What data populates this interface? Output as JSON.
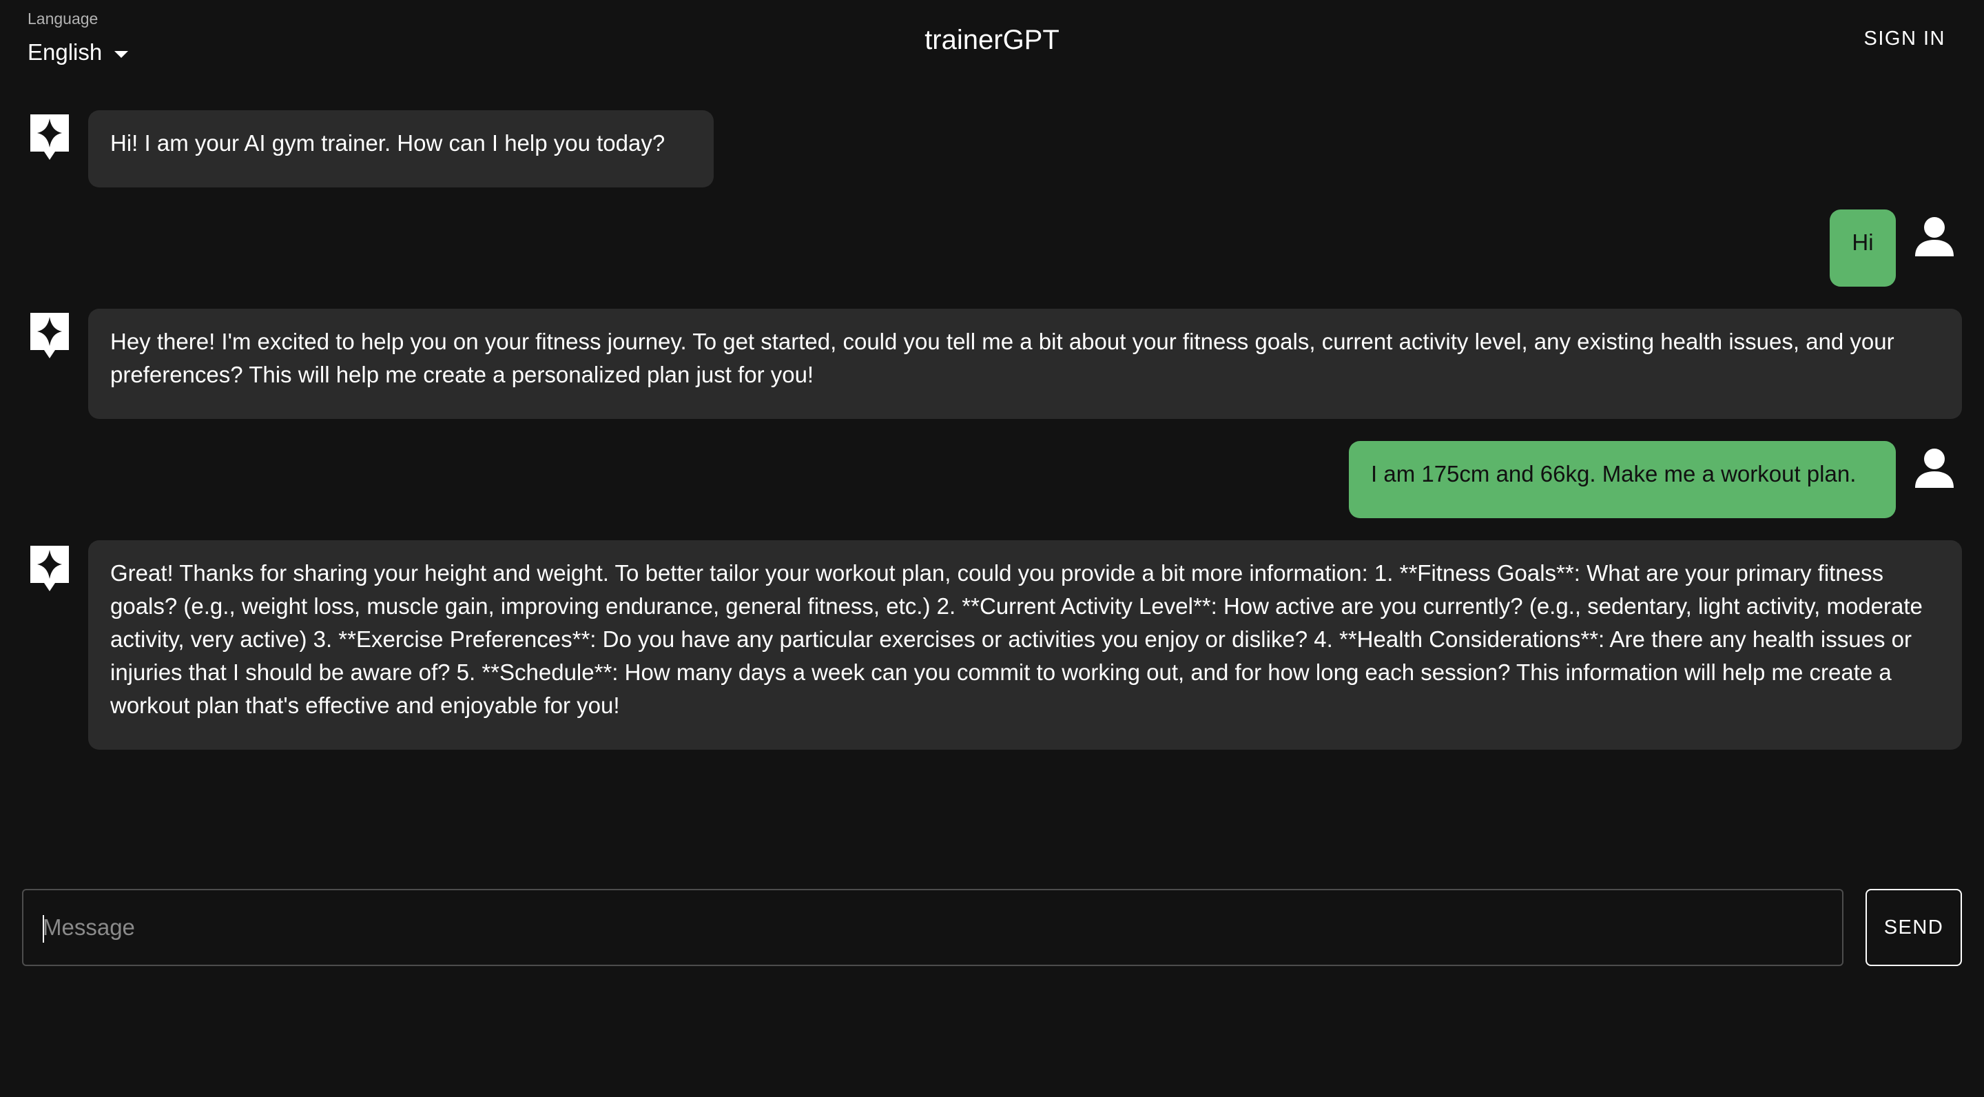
{
  "header": {
    "language_label": "Language",
    "language_value": "English",
    "title": "trainerGPT",
    "signin_label": "SIGN IN"
  },
  "messages": [
    {
      "role": "assistant",
      "icon": "sparkle-icon",
      "text": "Hi! I am your AI gym trainer. How can I help you today?"
    },
    {
      "role": "user",
      "icon": "user-icon",
      "text": "Hi"
    },
    {
      "role": "assistant",
      "icon": "sparkle-icon",
      "text": "Hey there! I'm excited to help you on your fitness journey. To get started, could you tell me a bit about your fitness goals, current activity level, any existing health issues, and your preferences? This will help me create a personalized plan just for you!"
    },
    {
      "role": "user",
      "icon": "user-icon",
      "text": "I am 175cm and 66kg. Make me a workout plan."
    },
    {
      "role": "assistant",
      "icon": "sparkle-icon",
      "text": "Great! Thanks for sharing your height and weight. To better tailor your workout plan, could you provide a bit more information: 1. **Fitness Goals**: What are your primary fitness goals? (e.g., weight loss, muscle gain, improving endurance, general fitness, etc.) 2. **Current Activity Level**: How active are you currently? (e.g., sedentary, light activity, moderate activity, very active) 3. **Exercise Preferences**: Do you have any particular exercises or activities you enjoy or dislike? 4. **Health Considerations**: Are there any health issues or injuries that I should be aware of? 5. **Schedule**: How many days a week can you commit to working out, and for how long each session? This information will help me create a workout plan that's effective and enjoyable for you!"
    }
  ],
  "composer": {
    "placeholder": "Message",
    "value": "",
    "send_label": "SEND"
  },
  "colors": {
    "background": "#121212",
    "assistant_bubble": "#2b2b2b",
    "user_bubble": "#5db56a"
  }
}
